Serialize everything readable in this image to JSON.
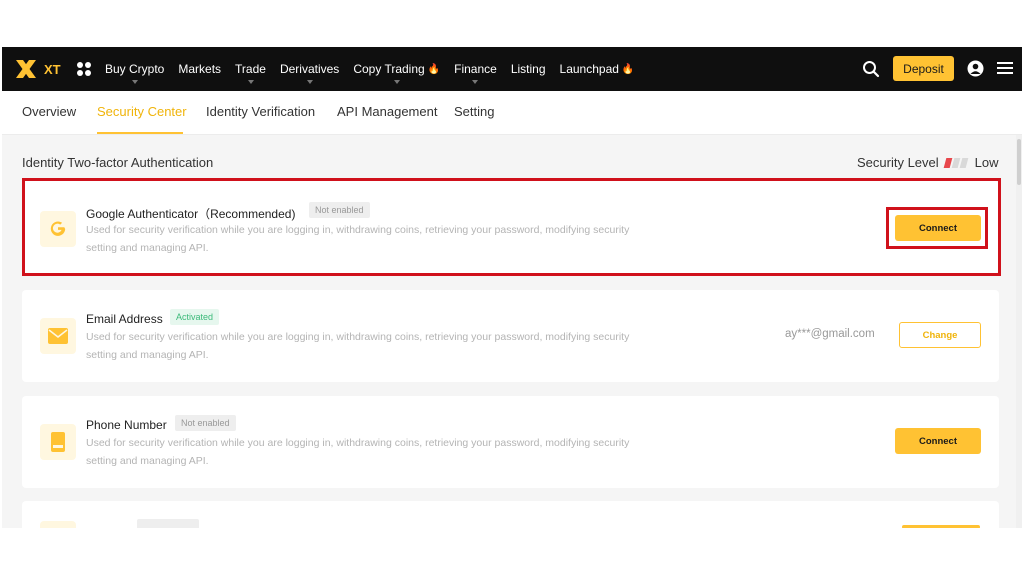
{
  "brand": {
    "name": "XT",
    "accent": "#ffc233",
    "nav_bg": "#0f0f0f",
    "highlight": "#d0111b"
  },
  "topnav": {
    "items": [
      {
        "label": "Buy Crypto",
        "fire": ""
      },
      {
        "label": "Markets",
        "fire": ""
      },
      {
        "label": "Trade",
        "fire": ""
      },
      {
        "label": "Derivatives",
        "fire": ""
      },
      {
        "label": "Copy Trading",
        "fire": "🔥"
      },
      {
        "label": "Finance",
        "fire": ""
      },
      {
        "label": "Listing",
        "fire": ""
      },
      {
        "label": "Launchpad",
        "fire": "🔥"
      }
    ],
    "deposit_label": "Deposit",
    "icons": [
      "apps-grid-icon",
      "search-icon",
      "user-icon",
      "menu-icon"
    ]
  },
  "tabs": [
    {
      "label": "Overview"
    },
    {
      "label": "Security Center",
      "active": true
    },
    {
      "label": "Identity Verification"
    },
    {
      "label": "API Management"
    },
    {
      "label": "Setting"
    }
  ],
  "section": {
    "title": "Identity Two-factor Authentication",
    "security_level_label": "Security Level",
    "security_level_value": "Low",
    "security_level_filled": 1,
    "security_level_total": 3
  },
  "cards": [
    {
      "icon": "google-g-icon",
      "title": "Google Authenticator（Recommended)",
      "badge": "Not enabled",
      "desc": "Used for security verification while you are logging in, withdrawing coins, retrieving your password, modifying security setting and managing API.",
      "action": "Connect"
    },
    {
      "icon": "envelope-icon",
      "title": "Email Address",
      "badge": "Activated",
      "desc": "Used for security verification while you are logging in, withdrawing coins, retrieving your password, modifying security setting and managing API.",
      "value": "ay***@gmail.com",
      "action": "Change"
    },
    {
      "icon": "phone-icon",
      "title": "Phone Number",
      "badge": "Not enabled",
      "desc": "Used for security verification while you are logging in, withdrawing coins, retrieving your password, modifying security setting and managing API.",
      "action": "Connect"
    }
  ]
}
